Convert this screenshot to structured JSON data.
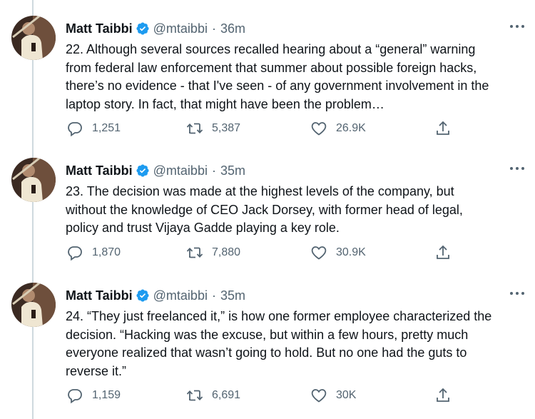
{
  "colors": {
    "text": "#0f1419",
    "secondary": "#536471",
    "verified": "#1d9bf0",
    "thread_line": "#cfd9de"
  },
  "tweets": [
    {
      "name": "Matt Taibbi",
      "handle": "@mtaibbi",
      "dot": "·",
      "time": "36m",
      "text_lines": [
        "22. Although several sources recalled hearing about a “general” warning",
        "from federal law enforcement that summer about possible foreign hacks,",
        "there’s no evidence - that I've seen - of any government involvement in the",
        "laptop story. In fact, that might have been the problem…"
      ],
      "replies": "1,251",
      "retweets": "5,387",
      "likes": "26.9K"
    },
    {
      "name": "Matt Taibbi",
      "handle": "@mtaibbi",
      "dot": "·",
      "time": "35m",
      "text_lines": [
        "23. The decision was made at the highest levels of the company, but",
        "without the knowledge of CEO Jack Dorsey, with former head of legal,",
        "policy and trust Vijaya Gadde playing a key role."
      ],
      "replies": "1,870",
      "retweets": "7,880",
      "likes": "30.9K"
    },
    {
      "name": "Matt Taibbi",
      "handle": "@mtaibbi",
      "dot": "·",
      "time": "35m",
      "text_lines": [
        "24. “They just freelanced it,” is how one former employee characterized the",
        "decision. “Hacking was the excuse, but within a few hours, pretty much",
        "everyone realized that wasn’t going to hold. But no one had the guts to",
        "reverse it.”"
      ],
      "replies": "1,159",
      "retweets": "6,691",
      "likes": "30K"
    }
  ],
  "icons": {
    "verified": "verified-badge-icon",
    "more": "more-options-icon",
    "reply": "reply-icon",
    "retweet": "retweet-icon",
    "like": "heart-icon",
    "share": "share-icon"
  }
}
